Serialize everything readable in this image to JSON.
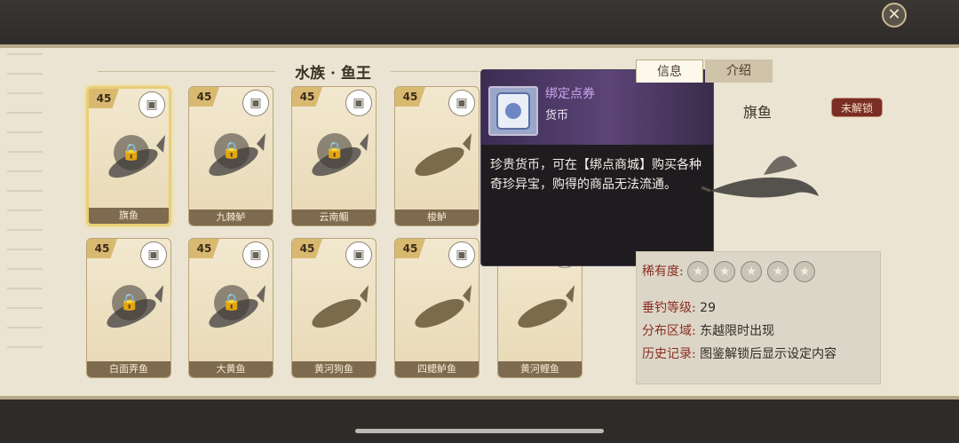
{
  "section": {
    "title": "水族 · 鱼王"
  },
  "close_icon": "close-x",
  "fish_cards": [
    {
      "level": "45",
      "name": "旗鱼",
      "locked": true,
      "selected": true
    },
    {
      "level": "45",
      "name": "九棘鲈",
      "locked": true,
      "selected": false
    },
    {
      "level": "45",
      "name": "云南鲴",
      "locked": true,
      "selected": false
    },
    {
      "level": "45",
      "name": "梭鲈",
      "locked": false,
      "selected": false
    },
    {
      "level": "45",
      "name": "白面弄鱼",
      "locked": true,
      "selected": false
    },
    {
      "level": "45",
      "name": "大黄鱼",
      "locked": true,
      "selected": false
    },
    {
      "level": "45",
      "name": "黄河狗鱼",
      "locked": false,
      "selected": false
    },
    {
      "level": "45",
      "name": "四鳃鲈鱼",
      "locked": false,
      "selected": false
    },
    {
      "level": "",
      "name": "黄河鲤鱼",
      "locked": false,
      "selected": false
    }
  ],
  "tooltip": {
    "item_name": "绑定点券",
    "item_type": "货币",
    "description": "珍贵货币，可在【绑点商城】购买各种奇珍异宝，购得的商品无法流通。"
  },
  "detail": {
    "tabs": {
      "info": "信息",
      "intro": "介绍"
    },
    "fish_name": "旗鱼",
    "unlock_status": "未解锁",
    "rarity_label": "稀有度:",
    "rarity_stars": 5,
    "level_label": "垂钓等级:",
    "level_value": "29",
    "area_label": "分布区域:",
    "area_value": "东越限时出现",
    "history_label": "历史记录:",
    "history_value": "图鉴解锁后显示设定内容"
  }
}
